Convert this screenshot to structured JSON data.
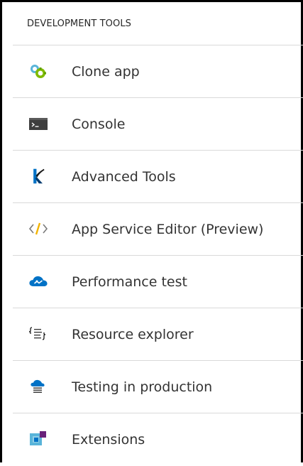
{
  "section": {
    "title": "DEVELOPMENT TOOLS"
  },
  "items": [
    {
      "label": "Clone app",
      "icon": "clone-app-icon"
    },
    {
      "label": "Console",
      "icon": "console-icon"
    },
    {
      "label": "Advanced Tools",
      "icon": "kudu-icon"
    },
    {
      "label": "App Service Editor (Preview)",
      "icon": "code-editor-icon"
    },
    {
      "label": "Performance test",
      "icon": "cloud-icon"
    },
    {
      "label": "Resource explorer",
      "icon": "resource-explorer-icon"
    },
    {
      "label": "Testing in production",
      "icon": "testing-in-production-icon"
    },
    {
      "label": "Extensions",
      "icon": "extensions-icon"
    }
  ],
  "colors": {
    "divider": "#d9d9d9",
    "text": "#333333",
    "azure_blue": "#0072c6",
    "green": "#7fba00",
    "purple": "#68217a"
  }
}
